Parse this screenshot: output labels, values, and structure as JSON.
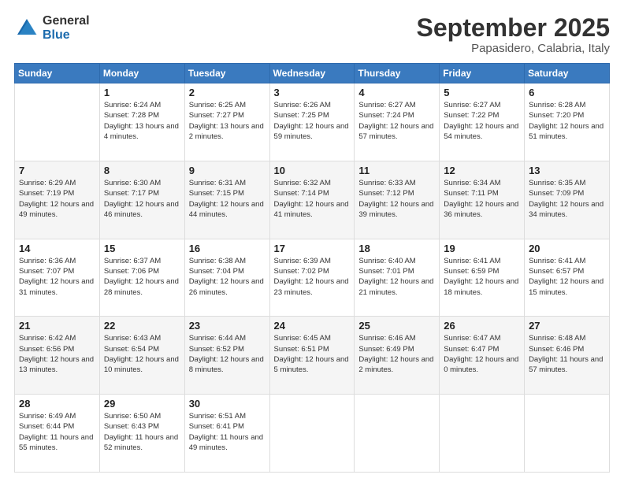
{
  "header": {
    "logo": {
      "general": "General",
      "blue": "Blue"
    },
    "month": "September 2025",
    "location": "Papasidero, Calabria, Italy"
  },
  "weekdays": [
    "Sunday",
    "Monday",
    "Tuesday",
    "Wednesday",
    "Thursday",
    "Friday",
    "Saturday"
  ],
  "weeks": [
    [
      {
        "day": "",
        "sunrise": "",
        "sunset": "",
        "daylight": ""
      },
      {
        "day": "1",
        "sunrise": "Sunrise: 6:24 AM",
        "sunset": "Sunset: 7:28 PM",
        "daylight": "Daylight: 13 hours and 4 minutes."
      },
      {
        "day": "2",
        "sunrise": "Sunrise: 6:25 AM",
        "sunset": "Sunset: 7:27 PM",
        "daylight": "Daylight: 13 hours and 2 minutes."
      },
      {
        "day": "3",
        "sunrise": "Sunrise: 6:26 AM",
        "sunset": "Sunset: 7:25 PM",
        "daylight": "Daylight: 12 hours and 59 minutes."
      },
      {
        "day": "4",
        "sunrise": "Sunrise: 6:27 AM",
        "sunset": "Sunset: 7:24 PM",
        "daylight": "Daylight: 12 hours and 57 minutes."
      },
      {
        "day": "5",
        "sunrise": "Sunrise: 6:27 AM",
        "sunset": "Sunset: 7:22 PM",
        "daylight": "Daylight: 12 hours and 54 minutes."
      },
      {
        "day": "6",
        "sunrise": "Sunrise: 6:28 AM",
        "sunset": "Sunset: 7:20 PM",
        "daylight": "Daylight: 12 hours and 51 minutes."
      }
    ],
    [
      {
        "day": "7",
        "sunrise": "Sunrise: 6:29 AM",
        "sunset": "Sunset: 7:19 PM",
        "daylight": "Daylight: 12 hours and 49 minutes."
      },
      {
        "day": "8",
        "sunrise": "Sunrise: 6:30 AM",
        "sunset": "Sunset: 7:17 PM",
        "daylight": "Daylight: 12 hours and 46 minutes."
      },
      {
        "day": "9",
        "sunrise": "Sunrise: 6:31 AM",
        "sunset": "Sunset: 7:15 PM",
        "daylight": "Daylight: 12 hours and 44 minutes."
      },
      {
        "day": "10",
        "sunrise": "Sunrise: 6:32 AM",
        "sunset": "Sunset: 7:14 PM",
        "daylight": "Daylight: 12 hours and 41 minutes."
      },
      {
        "day": "11",
        "sunrise": "Sunrise: 6:33 AM",
        "sunset": "Sunset: 7:12 PM",
        "daylight": "Daylight: 12 hours and 39 minutes."
      },
      {
        "day": "12",
        "sunrise": "Sunrise: 6:34 AM",
        "sunset": "Sunset: 7:11 PM",
        "daylight": "Daylight: 12 hours and 36 minutes."
      },
      {
        "day": "13",
        "sunrise": "Sunrise: 6:35 AM",
        "sunset": "Sunset: 7:09 PM",
        "daylight": "Daylight: 12 hours and 34 minutes."
      }
    ],
    [
      {
        "day": "14",
        "sunrise": "Sunrise: 6:36 AM",
        "sunset": "Sunset: 7:07 PM",
        "daylight": "Daylight: 12 hours and 31 minutes."
      },
      {
        "day": "15",
        "sunrise": "Sunrise: 6:37 AM",
        "sunset": "Sunset: 7:06 PM",
        "daylight": "Daylight: 12 hours and 28 minutes."
      },
      {
        "day": "16",
        "sunrise": "Sunrise: 6:38 AM",
        "sunset": "Sunset: 7:04 PM",
        "daylight": "Daylight: 12 hours and 26 minutes."
      },
      {
        "day": "17",
        "sunrise": "Sunrise: 6:39 AM",
        "sunset": "Sunset: 7:02 PM",
        "daylight": "Daylight: 12 hours and 23 minutes."
      },
      {
        "day": "18",
        "sunrise": "Sunrise: 6:40 AM",
        "sunset": "Sunset: 7:01 PM",
        "daylight": "Daylight: 12 hours and 21 minutes."
      },
      {
        "day": "19",
        "sunrise": "Sunrise: 6:41 AM",
        "sunset": "Sunset: 6:59 PM",
        "daylight": "Daylight: 12 hours and 18 minutes."
      },
      {
        "day": "20",
        "sunrise": "Sunrise: 6:41 AM",
        "sunset": "Sunset: 6:57 PM",
        "daylight": "Daylight: 12 hours and 15 minutes."
      }
    ],
    [
      {
        "day": "21",
        "sunrise": "Sunrise: 6:42 AM",
        "sunset": "Sunset: 6:56 PM",
        "daylight": "Daylight: 12 hours and 13 minutes."
      },
      {
        "day": "22",
        "sunrise": "Sunrise: 6:43 AM",
        "sunset": "Sunset: 6:54 PM",
        "daylight": "Daylight: 12 hours and 10 minutes."
      },
      {
        "day": "23",
        "sunrise": "Sunrise: 6:44 AM",
        "sunset": "Sunset: 6:52 PM",
        "daylight": "Daylight: 12 hours and 8 minutes."
      },
      {
        "day": "24",
        "sunrise": "Sunrise: 6:45 AM",
        "sunset": "Sunset: 6:51 PM",
        "daylight": "Daylight: 12 hours and 5 minutes."
      },
      {
        "day": "25",
        "sunrise": "Sunrise: 6:46 AM",
        "sunset": "Sunset: 6:49 PM",
        "daylight": "Daylight: 12 hours and 2 minutes."
      },
      {
        "day": "26",
        "sunrise": "Sunrise: 6:47 AM",
        "sunset": "Sunset: 6:47 PM",
        "daylight": "Daylight: 12 hours and 0 minutes."
      },
      {
        "day": "27",
        "sunrise": "Sunrise: 6:48 AM",
        "sunset": "Sunset: 6:46 PM",
        "daylight": "Daylight: 11 hours and 57 minutes."
      }
    ],
    [
      {
        "day": "28",
        "sunrise": "Sunrise: 6:49 AM",
        "sunset": "Sunset: 6:44 PM",
        "daylight": "Daylight: 11 hours and 55 minutes."
      },
      {
        "day": "29",
        "sunrise": "Sunrise: 6:50 AM",
        "sunset": "Sunset: 6:43 PM",
        "daylight": "Daylight: 11 hours and 52 minutes."
      },
      {
        "day": "30",
        "sunrise": "Sunrise: 6:51 AM",
        "sunset": "Sunset: 6:41 PM",
        "daylight": "Daylight: 11 hours and 49 minutes."
      },
      {
        "day": "",
        "sunrise": "",
        "sunset": "",
        "daylight": ""
      },
      {
        "day": "",
        "sunrise": "",
        "sunset": "",
        "daylight": ""
      },
      {
        "day": "",
        "sunrise": "",
        "sunset": "",
        "daylight": ""
      },
      {
        "day": "",
        "sunrise": "",
        "sunset": "",
        "daylight": ""
      }
    ]
  ]
}
